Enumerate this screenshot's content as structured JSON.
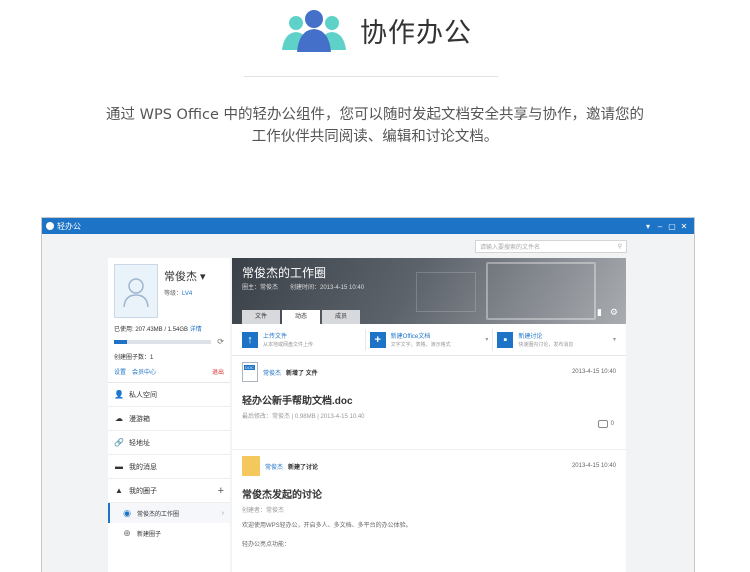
{
  "hero": {
    "title": "协作办公",
    "intro_line1": "通过 WPS Office 中的轻办公组件，您可以随时发起文档安全共享与协作，邀请您的",
    "intro_line2": "工作伙伴共同阅读、编辑和讨论文档。",
    "icon": "people-icon",
    "accent": "#4fc3c2"
  },
  "window": {
    "title": "轻办公",
    "controls": [
      "▾",
      "–",
      "▢",
      "✕"
    ],
    "search_placeholder": "请输入要搜索的文件名",
    "titlebar_color": "#1d73c6"
  },
  "sidebar": {
    "user_name": "常俊杰",
    "level_label": "等级：",
    "level_value": "LV4",
    "usage_label": "已使用: 207.43MB / 1.54GB",
    "usage_detail": "详情",
    "usage_fraction": 0.13,
    "circle_count": "创建圈子数：1",
    "settings": "设置",
    "member_center": "会员中心",
    "logout": "退出",
    "nav": [
      {
        "icon": "user-icon",
        "label": "私人空间"
      },
      {
        "icon": "cloud-icon",
        "label": "漫游箱"
      },
      {
        "icon": "link-icon",
        "label": "轻地址"
      },
      {
        "icon": "message-icon",
        "label": "我的消息"
      },
      {
        "icon": "triangle-icon",
        "label": "我的圈子"
      }
    ],
    "circles": [
      {
        "label": "常俊杰的工作圈"
      },
      {
        "label": "新建圈子"
      }
    ]
  },
  "main": {
    "banner_title": "常俊杰的工作圈",
    "banner_meta": "圈主：常俊杰　　创建时间：2013-4-15 10:40",
    "tabs": [
      "文件",
      "动态",
      "成员"
    ],
    "actions": [
      {
        "title": "上传文件",
        "desc": "从本地或网盘文件上传"
      },
      {
        "title": "新建Office文档",
        "desc": "文字文字，表格，演示格式"
      },
      {
        "title": "新建讨论",
        "desc": "快速圈内讨论，发布消息"
      }
    ],
    "feed": [
      {
        "who": "常俊杰",
        "what": "新增了 文件",
        "time": "2013-4-15 10:40",
        "title": "轻办公新手帮助文档.doc",
        "sub": "最后修改：常俊杰 | 0.98MB | 2013-4-15 10:40",
        "comments": "0"
      },
      {
        "who": "常俊杰",
        "what": "新建了讨论",
        "time": "2013-4-15 10:40",
        "title": "常俊杰发起的讨论",
        "sub": "创建者：常俊杰",
        "body": "欢迎使用WPS轻办公，开启多人、多文档、多平台的办公体验。",
        "body2": "轻办公亮点功能："
      }
    ]
  }
}
